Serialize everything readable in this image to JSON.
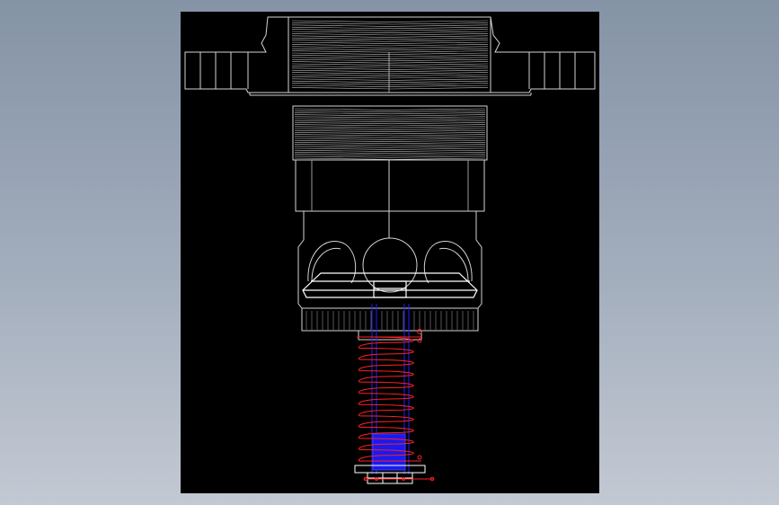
{
  "colors": {
    "background_top": "#8593a6",
    "background_bottom": "#c3c9d3",
    "viewport": "#000000",
    "outline": "#d4d4d4",
    "highlight": "#ffffff",
    "spring": "#ff2020",
    "shaft": "#2020ff"
  },
  "drawing": {
    "view": "front elevation",
    "parts": [
      "flange-nut",
      "threaded-body",
      "ball-housing",
      "ball-set",
      "spring",
      "rod",
      "base-plate"
    ],
    "ball_count": 3,
    "spring_coils": 11
  }
}
